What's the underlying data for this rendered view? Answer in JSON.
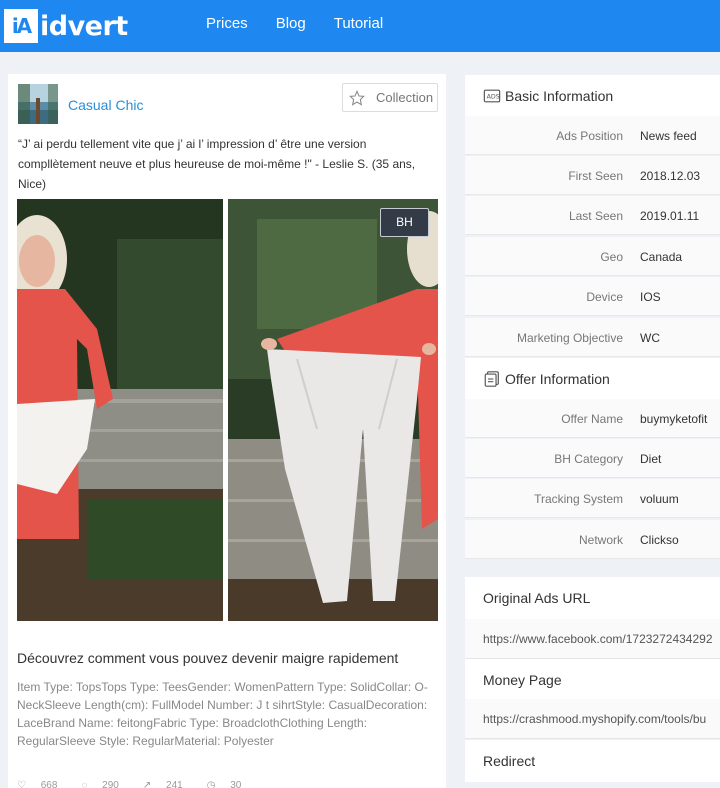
{
  "header": {
    "logo_mark": "iA",
    "logo_text": "idvert",
    "nav": [
      "Prices",
      "Blog",
      "Tutorial"
    ]
  },
  "ad": {
    "brand": "Casual Chic",
    "collection_label": "Collection",
    "quote": "“J’ ai perdu tellement vite que j’ ai l’ impression d’ être une version compllètement neuve et plus heureuse de moi-même !\" - Leslie S. (35 ans, Nice)",
    "badge": "BH",
    "title": "Découvrez comment vous pouvez devenir maigre rapidement",
    "description": "Item Type: TopsTops Type: TeesGender: WomenPattern Type: SolidCollar: O-NeckSleeve Length(cm): FullModel Number: J t sihrtStyle: CasualDecoration: LaceBrand Name: feitongFabric Type: BroadclothClothing Length: RegularSleeve Style: RegularMaterial: Polyester",
    "stats": {
      "likes": "668",
      "comments": "290",
      "shares": "241",
      "views": "30"
    }
  },
  "basic_info": {
    "title": "Basic Information",
    "rows": [
      {
        "label": "Ads Position",
        "value": "News feed"
      },
      {
        "label": "First Seen",
        "value": "2018.12.03"
      },
      {
        "label": "Last Seen",
        "value": "2019.01.11"
      },
      {
        "label": "Geo",
        "value": "Canada"
      },
      {
        "label": "Device",
        "value": "IOS"
      },
      {
        "label": "Marketing Objective",
        "value": "WC"
      }
    ]
  },
  "offer_info": {
    "title": "Offer Information",
    "rows": [
      {
        "label": "Offer Name",
        "value": "buymyketofit"
      },
      {
        "label": "BH Category",
        "value": "Diet"
      },
      {
        "label": "Tracking System",
        "value": "voluum"
      },
      {
        "label": "Network",
        "value": "Clickso"
      }
    ]
  },
  "links": {
    "original_title": "Original Ads URL",
    "original_url": "https://www.facebook.com/1723272434292",
    "money_title": "Money Page",
    "money_url": "https://crashmood.myshopify.com/tools/bu",
    "redirect_title": "Redirect"
  },
  "colors": {
    "brand_blue": "#1e88f0",
    "link_blue": "#2b8fd8"
  }
}
